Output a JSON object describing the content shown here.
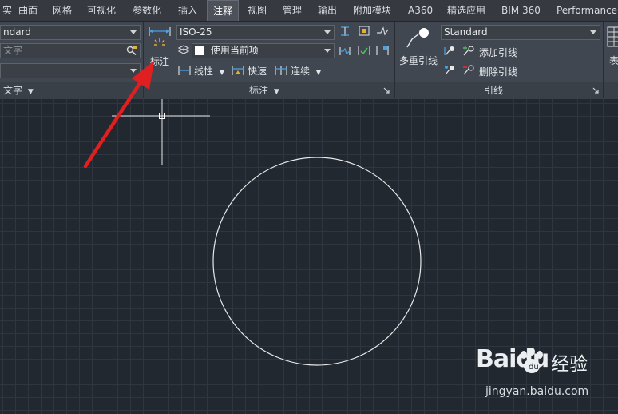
{
  "tabs": [
    {
      "label": "实"
    },
    {
      "label": "曲面"
    },
    {
      "label": "网格"
    },
    {
      "label": "可视化"
    },
    {
      "label": "参数化"
    },
    {
      "label": "插入"
    },
    {
      "label": "注释",
      "active": true
    },
    {
      "label": "视图"
    },
    {
      "label": "管理"
    },
    {
      "label": "输出"
    },
    {
      "label": "附加模块"
    },
    {
      "label": "A360"
    },
    {
      "label": "精选应用"
    },
    {
      "label": "BIM 360"
    },
    {
      "label": "Performance"
    }
  ],
  "text_panel": {
    "style_value": "ndard",
    "search_placeholder": "文字",
    "title": "文字"
  },
  "dimension_panel": {
    "big_button_label": "标注",
    "style_value": "ISO-25",
    "layer_value": "使用当前项",
    "linear_label": "线性",
    "quick_label": "快速",
    "continue_label": "连续",
    "title": "标注"
  },
  "leader_panel": {
    "big_button_label": "多重引线",
    "style_value": "Standard",
    "add_label": "添加引线",
    "remove_label": "删除引线",
    "title": "引线"
  },
  "table_panel": {
    "label": "表"
  },
  "watermark": {
    "brand": "Baidu",
    "cn": "经验",
    "url": "jingyan.baidu.com"
  },
  "colors": {
    "accent": "#e02020",
    "tab_bar": "#363a40",
    "ribbon": "#404750",
    "canvas": "#212830",
    "grid": "#2f3640",
    "circle": "#e8e8e8"
  }
}
